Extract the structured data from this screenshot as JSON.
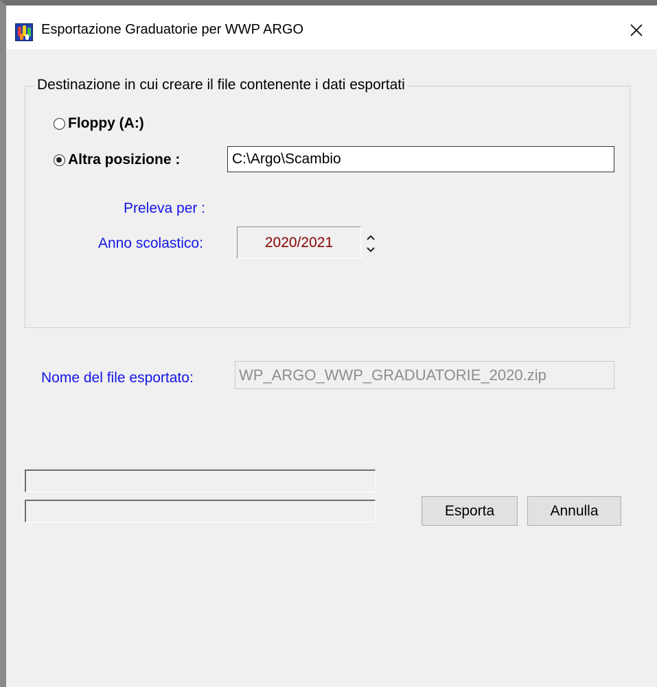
{
  "window": {
    "title": "Esportazione Graduatorie per WWP ARGO",
    "close_glyph": "✕",
    "icon": "argo-app-icon"
  },
  "destination": {
    "legend": "Destinazione in cui creare il file contenente i dati esportati",
    "floppy_label": "Floppy (A:)",
    "floppy_checked": false,
    "other_label": "Altra posizione :",
    "other_checked": true,
    "path_value": "C:\\Argo\\Scambio",
    "fetch_for_label": "Preleva per :",
    "school_year_label": "Anno scolastico:",
    "school_year_value": "2020/2021"
  },
  "export_file": {
    "label": "Nome del file esportato:",
    "value": "WP_ARGO_WWP_GRADUATORIE_2020.zip"
  },
  "progress": {
    "bar1": 0,
    "bar2": 0
  },
  "buttons": {
    "export_label": "Esporta",
    "cancel_label": "Annulla"
  },
  "colors": {
    "label_blue": "#1414e6",
    "year_red": "#8b0000",
    "disabled_text": "#8d8d8d",
    "window_bg": "#f0f0f0"
  }
}
